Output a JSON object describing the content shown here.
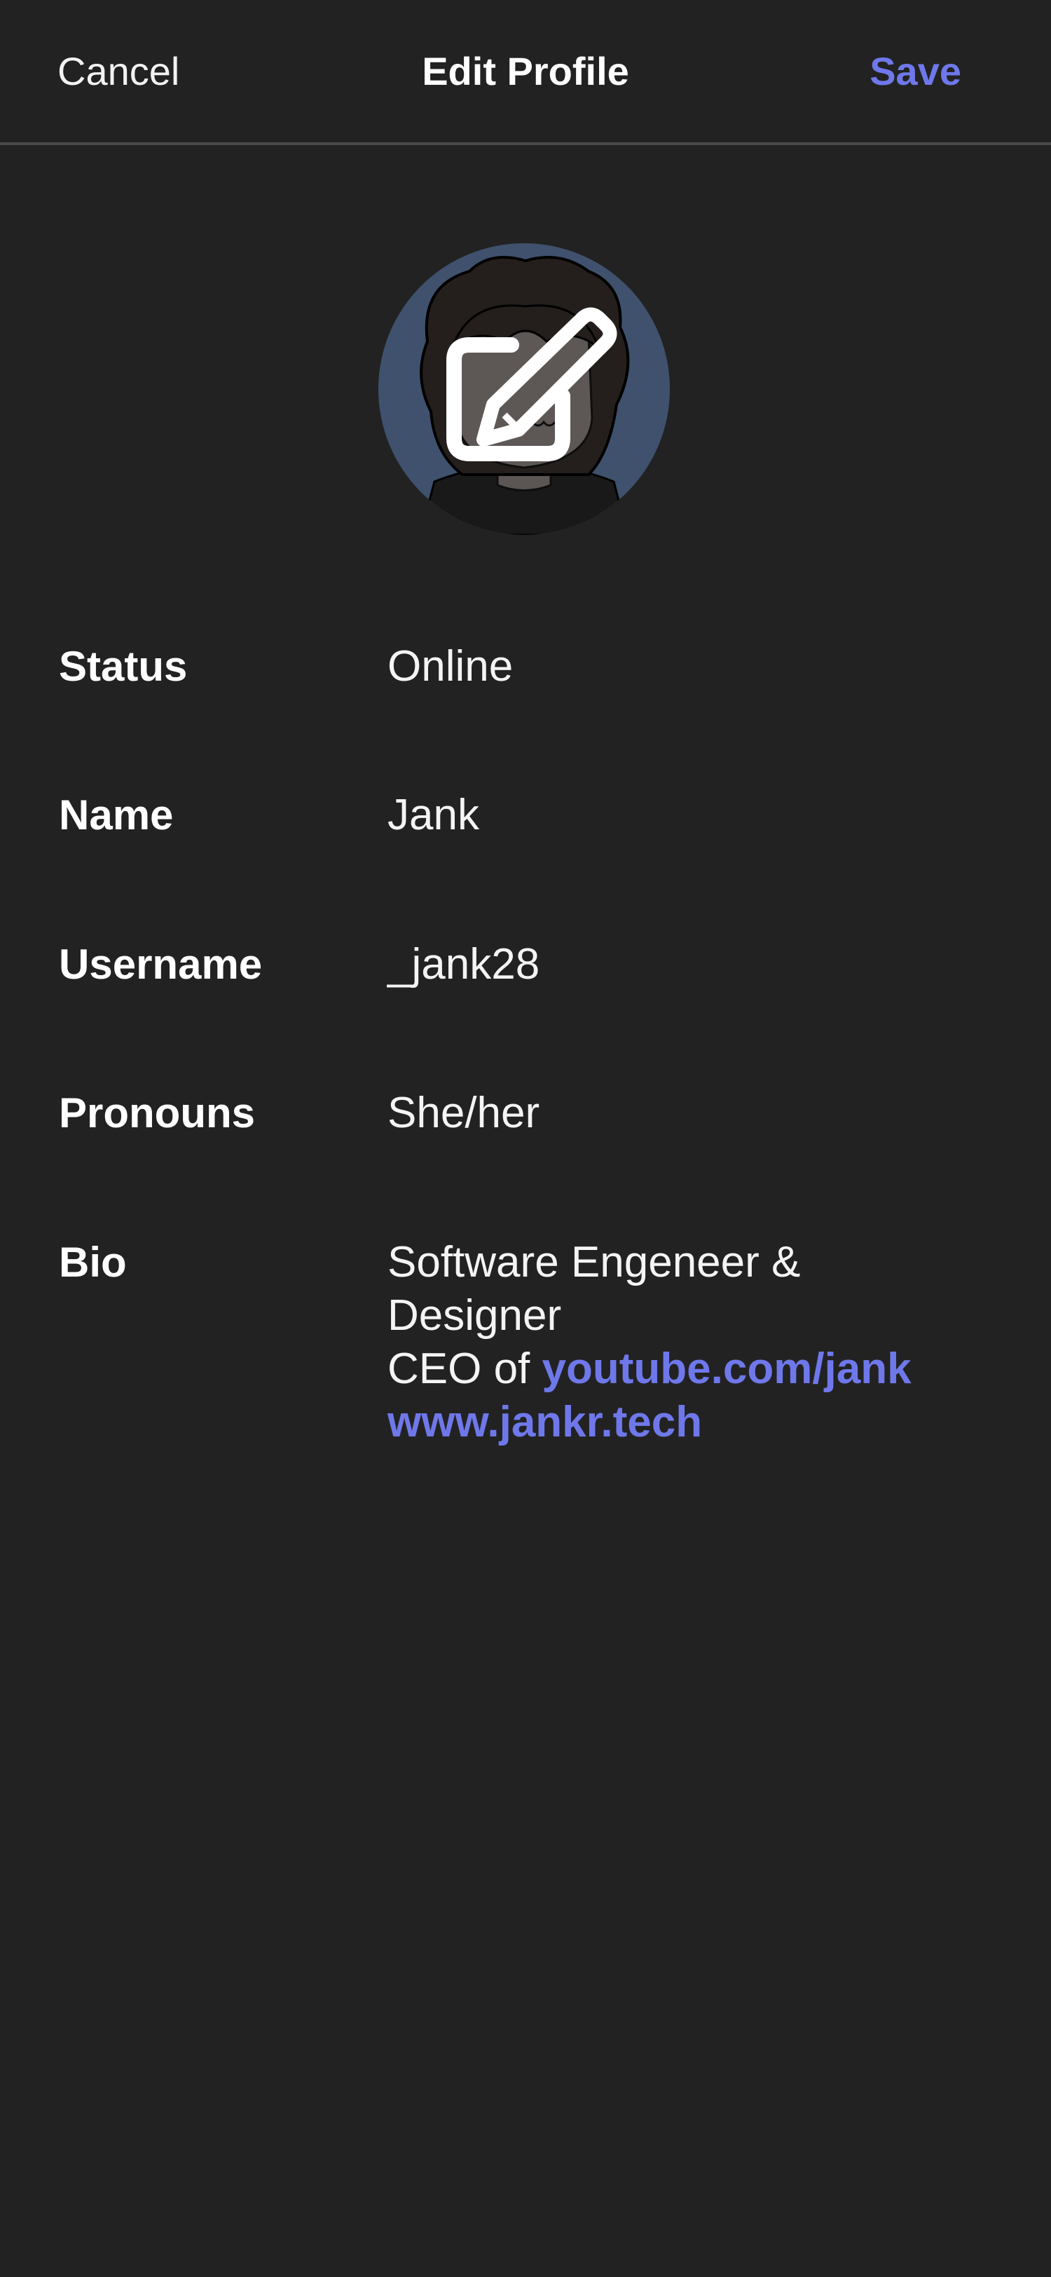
{
  "header": {
    "cancel_label": "Cancel",
    "title": "Edit Profile",
    "save_label": "Save"
  },
  "avatar": {
    "icon": "pencil-edit-icon"
  },
  "fields": {
    "status": {
      "label": "Status",
      "value": "Online"
    },
    "name": {
      "label": "Name",
      "value": "Jank"
    },
    "username": {
      "label": "Username",
      "value": "_jank28"
    },
    "pronouns": {
      "label": "Pronouns",
      "value": "She/her"
    },
    "bio": {
      "label": "Bio",
      "line1": "Software Engeneer &",
      "line2": "Designer",
      "line3_prefix": "CEO of ",
      "link1": "youtube.com/jank",
      "link2": "www.jankr.tech"
    }
  },
  "colors": {
    "background": "#222222",
    "accent": "#6f78ea",
    "divider": "#4a4a4a"
  }
}
